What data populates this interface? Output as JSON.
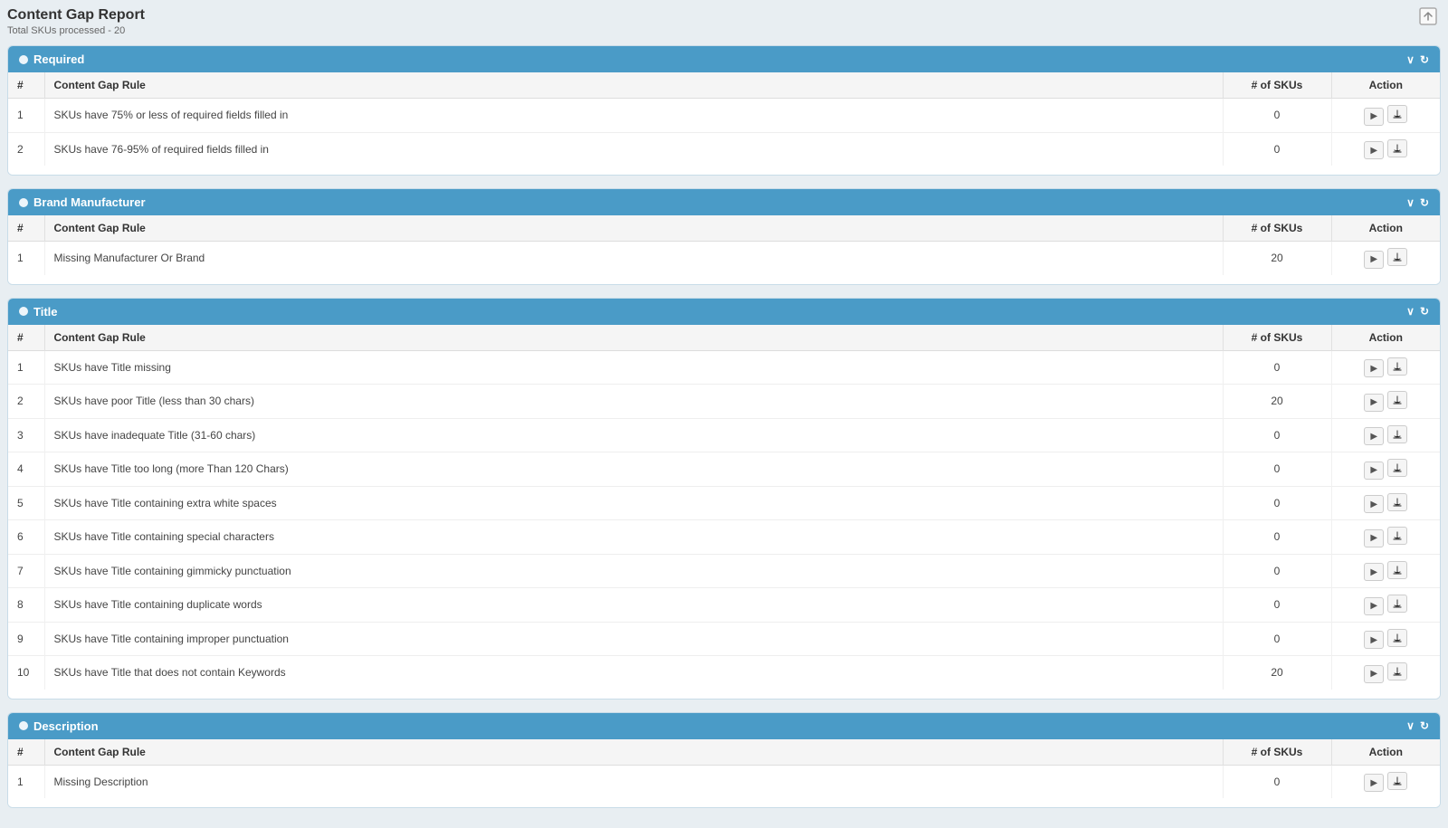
{
  "page": {
    "title": "Content Gap Report",
    "subtitle": "Total SKUs processed - 20",
    "export_label": "Export"
  },
  "sections": [
    {
      "id": "required",
      "header": "Required",
      "collapse_label": "▾",
      "refresh_label": "↻",
      "columns": [
        "#",
        "Content Gap Rule",
        "# of SKUs",
        "Action"
      ],
      "rows": [
        {
          "num": 1,
          "rule": "SKUs have 75% or less of required fields filled in",
          "skus": "0"
        },
        {
          "num": 2,
          "rule": "SKUs have 76-95% of required fields filled in",
          "skus": "0"
        }
      ]
    },
    {
      "id": "brand-manufacturer",
      "header": "Brand Manufacturer",
      "collapse_label": "▾",
      "refresh_label": "↻",
      "columns": [
        "#",
        "Content Gap Rule",
        "# of SKUs",
        "Action"
      ],
      "rows": [
        {
          "num": 1,
          "rule": "Missing Manufacturer Or Brand",
          "skus": "20"
        }
      ]
    },
    {
      "id": "title",
      "header": "Title",
      "collapse_label": "▾",
      "refresh_label": "↻",
      "columns": [
        "#",
        "Content Gap Rule",
        "# of SKUs",
        "Action"
      ],
      "rows": [
        {
          "num": 1,
          "rule": "SKUs have Title missing",
          "skus": "0"
        },
        {
          "num": 2,
          "rule": "SKUs have poor Title (less than 30 chars)",
          "skus": "20"
        },
        {
          "num": 3,
          "rule": "SKUs have inadequate Title (31-60 chars)",
          "skus": "0"
        },
        {
          "num": 4,
          "rule": "SKUs have Title too long (more Than 120 Chars)",
          "skus": "0"
        },
        {
          "num": 5,
          "rule": "SKUs have Title containing extra white spaces",
          "skus": "0"
        },
        {
          "num": 6,
          "rule": "SKUs have Title containing special characters",
          "skus": "0"
        },
        {
          "num": 7,
          "rule": "SKUs have Title containing gimmicky punctuation",
          "skus": "0"
        },
        {
          "num": 8,
          "rule": "SKUs have Title containing duplicate words",
          "skus": "0"
        },
        {
          "num": 9,
          "rule": "SKUs have Title containing improper punctuation",
          "skus": "0"
        },
        {
          "num": 10,
          "rule": "SKUs have Title that does not contain Keywords",
          "skus": "20"
        }
      ]
    },
    {
      "id": "description",
      "header": "Description",
      "collapse_label": "▾",
      "refresh_label": "↻",
      "columns": [
        "#",
        "Content Gap Rule",
        "# of SKUs",
        "Action"
      ],
      "rows": [
        {
          "num": 1,
          "rule": "Missing Description",
          "skus": "0"
        }
      ]
    }
  ],
  "icons": {
    "play": "▶",
    "download": "▲",
    "collapse": "∨",
    "refresh": "↻",
    "dot": "●",
    "export": "⬜"
  }
}
